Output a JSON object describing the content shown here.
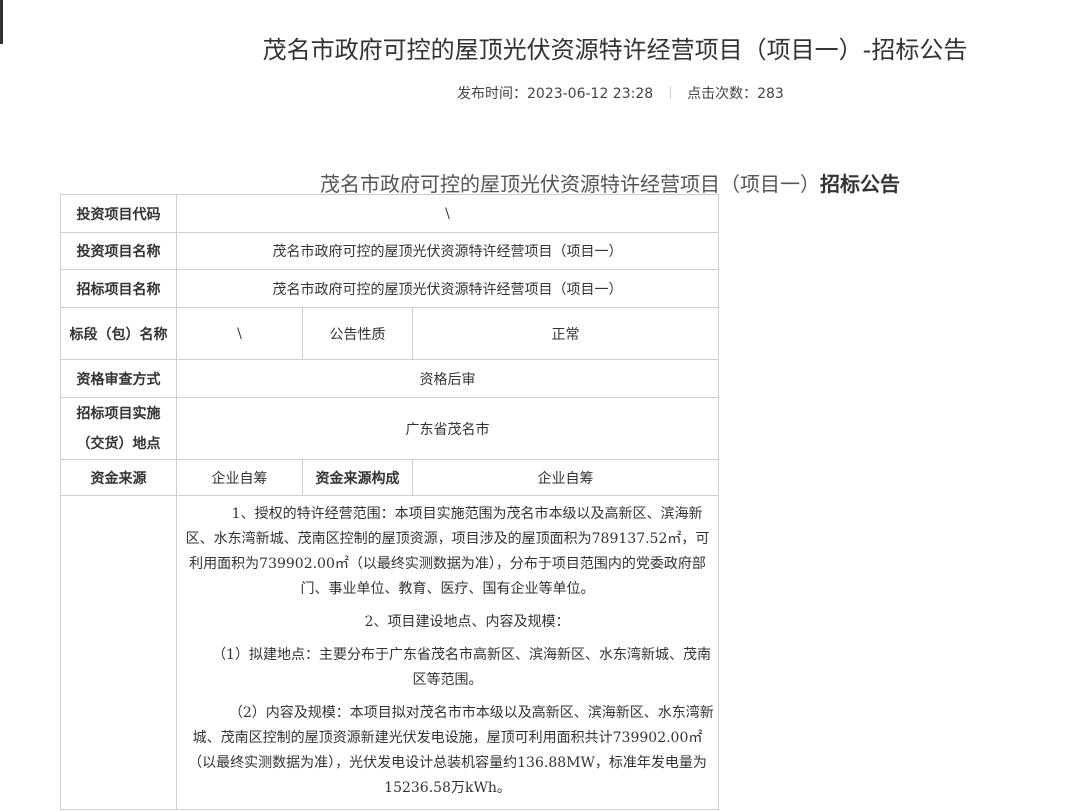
{
  "page": {
    "title": "茂名市政府可控的屋顶光伏资源特许经营项目（项目一）-招标公告",
    "publish_label": "发布时间：",
    "publish_time": "2023-06-12 23:28",
    "clicks_label": "点击次数：",
    "clicks": "283"
  },
  "doc": {
    "title_plain": "茂名市政府可控的屋顶光伏资源特许经营项目（项目一）",
    "title_bold": "招标公告"
  },
  "table": {
    "r1": {
      "label": "投资项目代码",
      "value": "\\"
    },
    "r2": {
      "label": "投资项目名称",
      "value": "茂名市政府可控的屋顶光伏资源特许经营项目（项目一）"
    },
    "r3": {
      "label": "招标项目名称",
      "value": "茂名市政府可控的屋顶光伏资源特许经营项目（项目一）"
    },
    "r4": {
      "label": "标段（包）名称",
      "value": "\\",
      "label2": "公告性质",
      "value2": "正常"
    },
    "r5": {
      "label": "资格审查方式",
      "value": "资格后审"
    },
    "r6": {
      "label": "招标项目实施（交货）地点",
      "value": "广东省茂名市"
    },
    "r7": {
      "label": "资金来源",
      "value": "企业自筹",
      "label2": "资金来源构成",
      "value2": "企业自筹"
    },
    "content": {
      "p1": "1、授权的特许经营范围：本项目实施范围为茂名市本级以及高新区、滨海新区、水东湾新城、茂南区控制的屋顶资源，项目涉及的屋顶面积为789137.52㎡，可利用面积为739902.00㎡（以最终实测数据为准），分布于项目范围内的党委政府部门、事业单位、教育、医疗、国有企业等单位。",
      "p2": "2、项目建设地点、内容及规模：",
      "p3": "（1）拟建地点：主要分布于广东省茂名市高新区、滨海新区、水东湾新城、茂南区等范围。",
      "p4": "（2）内容及规模：本项目拟对茂名市市本级以及高新区、滨海新区、水东湾新城、茂南区控制的屋顶资源新建光伏发电设施，屋顶可利用面积共计739902.00㎡（以最终实测数据为准），光伏发电设计总装机容量约136.88MW，标准年发电量为15236.58万kWh。"
    }
  }
}
